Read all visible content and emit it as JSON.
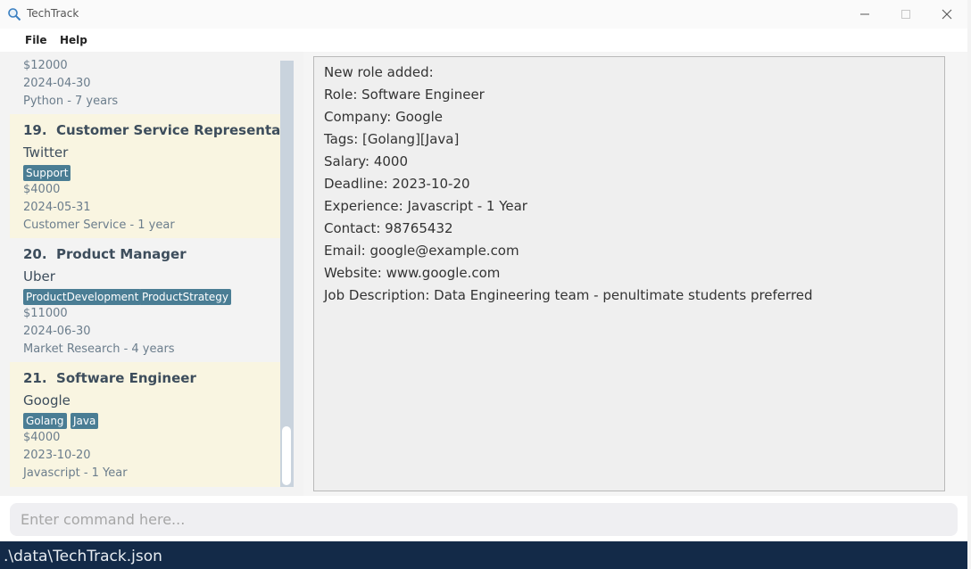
{
  "window": {
    "title": "TechTrack",
    "minimize_icon": "minimize-icon",
    "maximize_icon": "maximize-icon",
    "close_icon": "close-icon"
  },
  "menu": {
    "file": "File",
    "help": "Help"
  },
  "list": {
    "partial_card": {
      "salary": "$12000",
      "deadline": "2024-04-30",
      "experience": "Python - 7 years"
    },
    "cards": [
      {
        "index": "19.",
        "role": "Customer Service Representative",
        "company": "Twitter",
        "tags": [
          "Support"
        ],
        "salary": "$4000",
        "deadline": "2024-05-31",
        "experience": "Customer Service - 1 year"
      },
      {
        "index": "20.",
        "role": "Product Manager",
        "company": "Uber",
        "tags": [
          "ProductDevelopment",
          "ProductStrategy"
        ],
        "salary": "$11000",
        "deadline": "2024-06-30",
        "experience": "Market Research - 4 years"
      },
      {
        "index": "21.",
        "role": "Software Engineer",
        "company": "Google",
        "tags": [
          "Golang",
          "Java"
        ],
        "salary": "$4000",
        "deadline": "2023-10-20",
        "experience": "Javascript - 1 Year"
      }
    ]
  },
  "result": {
    "lines": [
      "New role added:",
      "Role: Software Engineer",
      "Company: Google",
      "Tags: [Golang][Java]",
      "Salary: 4000",
      "Deadline: 2023-10-20",
      "Experience: Javascript - 1 Year",
      "Contact: 98765432",
      "Email: google@example.com",
      "Website: www.google.com",
      "Job Description: Data Engineering team - penultimate students preferred"
    ]
  },
  "command": {
    "placeholder": "Enter command here...",
    "value": ""
  },
  "status": {
    "path": ".\\data\\TechTrack.json"
  },
  "colors": {
    "card_alt_bg": "#f9f5e1",
    "tag_bg": "#4a7d94",
    "status_bg": "#132a48"
  }
}
